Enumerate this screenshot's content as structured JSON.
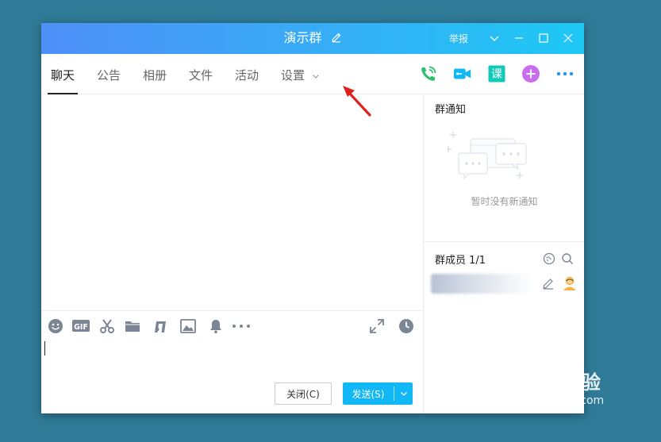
{
  "window": {
    "title": "演示群",
    "report_label": "举报"
  },
  "tabs": [
    {
      "label": "聊天",
      "active": true
    },
    {
      "label": "公告",
      "active": false
    },
    {
      "label": "相册",
      "active": false
    },
    {
      "label": "文件",
      "active": false
    },
    {
      "label": "活动",
      "active": false
    },
    {
      "label": "设置",
      "active": false,
      "has_dropdown": true
    }
  ],
  "nav_icons": [
    "phone-call-icon",
    "video-call-icon",
    "class-icon",
    "add-app-icon",
    "more-icon"
  ],
  "class_icon_glyph": "课",
  "toolbar_icons": [
    "emoji-icon",
    "gif-icon",
    "scissors-icon",
    "folder-icon",
    "music-icon",
    "image-icon",
    "bell-icon",
    "more-icon",
    "expand-icon",
    "history-icon"
  ],
  "gif_label": "GIF",
  "buttons": {
    "close": "关闭(C)",
    "send": "发送(S)"
  },
  "notice": {
    "title": "群通知",
    "empty_text": "暂时没有新通知"
  },
  "members": {
    "title": "群成员 1/1"
  },
  "watermark": {
    "brand": "Baidu经验",
    "url": "jingyan.baidu.com"
  },
  "colors": {
    "titlebar_start": "#4f8ff8",
    "titlebar_end": "#1ec8f5",
    "send_button": "#12b7f5",
    "desktop": "#2f7a96"
  }
}
